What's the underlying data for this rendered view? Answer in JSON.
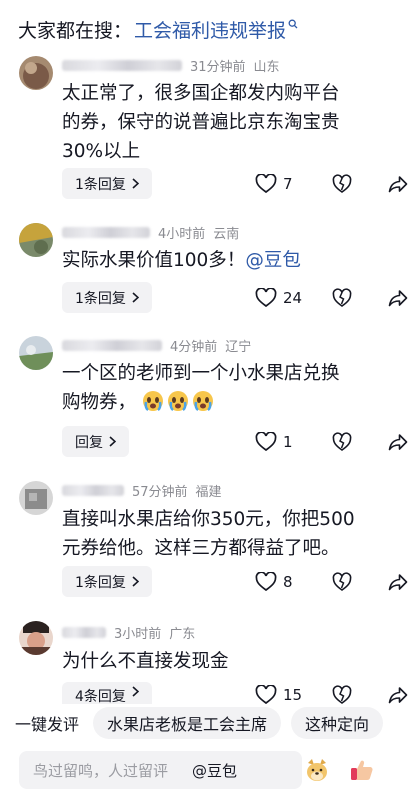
{
  "search": {
    "prefix": "大家都在搜：",
    "link": "工会福利违规举报"
  },
  "comments": [
    {
      "time": "31分钟前",
      "location": "山东",
      "lines": [
        "太正常了，很多国企都发内购平台",
        "的券，保守的说普遍比京东淘宝贵",
        "30%以上"
      ],
      "reply_label": "1条回复",
      "likes": "7",
      "avatar_colors": [
        "#7a5a48",
        "#a58a70"
      ]
    },
    {
      "time": "4小时前",
      "location": "云南",
      "text_before": "实际水果价值100多！",
      "mention": "@豆包",
      "reply_label": "1条回复",
      "likes": "24",
      "avatar_colors": [
        "#c6a33c",
        "#7a8a6a"
      ]
    },
    {
      "time": "4分钟前",
      "location": "辽宁",
      "lines": [
        "一个区的老师到一个小水果店兑换",
        "购物券，"
      ],
      "emoji_name": "crying-face-emoji",
      "reply_label": "回复",
      "likes": "1",
      "avatar_colors": [
        "#6f8f5a",
        "#c9d3dc"
      ]
    },
    {
      "time": "57分钟前",
      "location": "福建",
      "lines": [
        "直接叫水果店给你350元，你把500",
        "元券给他。这样三方都得益了吧。"
      ],
      "reply_label": "1条回复",
      "likes": "8",
      "avatar_colors": [
        "#8c8c8c",
        "#d6d6d6"
      ]
    },
    {
      "time": "3小时前",
      "location": "广东",
      "lines": [
        "为什么不直接发现金"
      ],
      "reply_label": "4条回复",
      "likes": "15",
      "avatar_colors": [
        "#5a3a30",
        "#d9a08a"
      ]
    }
  ],
  "quick_reply": {
    "label": "一键发评",
    "chips": [
      "水果店老板是工会主席",
      "这种定向"
    ]
  },
  "input": {
    "placeholder": "鸟过留鸣，人过留评",
    "mention": "@豆包",
    "emojis": [
      "doge-emoji",
      "thumbs-up-emoji"
    ]
  },
  "colors": {
    "link": "#2f5aa8",
    "meta": "#8a8b91",
    "chip_bg": "#f2f2f4"
  }
}
